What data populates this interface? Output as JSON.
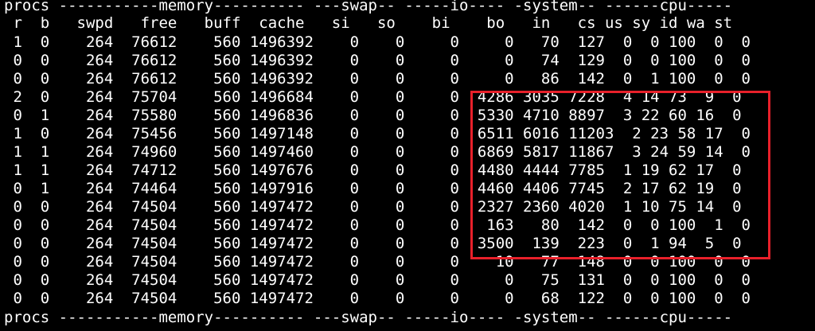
{
  "terminal": {
    "lines": [
      "procs -----------memory---------- ---swap-- -----io---- -system-- ------cpu-----",
      " r  b   swpd   free   buff  cache   si   so    bi    bo   in   cs us sy id wa st",
      " 1  0    264  76612    560 1496392    0    0     0     0   70  127  0  0 100  0  0",
      " 0  0    264  76612    560 1496392    0    0     0     0   74  129  0  0 100  0  0",
      " 0  0    264  76612    560 1496392    0    0     0     0   86  142  0  1 100  0  0",
      " 2  0    264  75704    560 1496684    0    0     0  4286 3035 7228  4 14 73  9  0",
      " 0  1    264  75580    560 1496836    0    0     0  5330 4710 8897  3 22 60 16  0",
      " 1  0    264  75456    560 1497148    0    0     0  6511 6016 11203  2 23 58 17  0",
      " 1  1    264  74960    560 1497460    0    0     0  6869 5817 11867  3 24 59 14  0",
      " 1  1    264  74712    560 1497676    0    0     0  4480 4444 7785  1 19 62 17  0",
      " 0  1    264  74464    560 1497916    0    0     0  4460 4406 7745  2 17 62 19  0",
      " 0  0    264  74504    560 1497472    0    0     0  2327 2360 4020  1 10 75 14  0",
      " 0  0    264  74504    560 1497472    0    0     0   163   80  142  0  0 100  1  0",
      " 0  0    264  74504    560 1497472    0    0     0  3500  139  223  0  1 94  5  0",
      " 0  0    264  74504    560 1497472    0    0     0    10   77  148  0  0 100  0  0",
      " 0  0    264  74504    560 1497472    0    0     0     0   75  131  0  0 100  0  0",
      " 0  0    264  74504    560 1497472    0    0     0     0   68  122  0  0 100  0  0",
      "procs -----------memory---------- ---swap-- -----io---- -system-- ------cpu-----"
    ]
  },
  "highlight": {
    "color": "#e8202a"
  }
}
